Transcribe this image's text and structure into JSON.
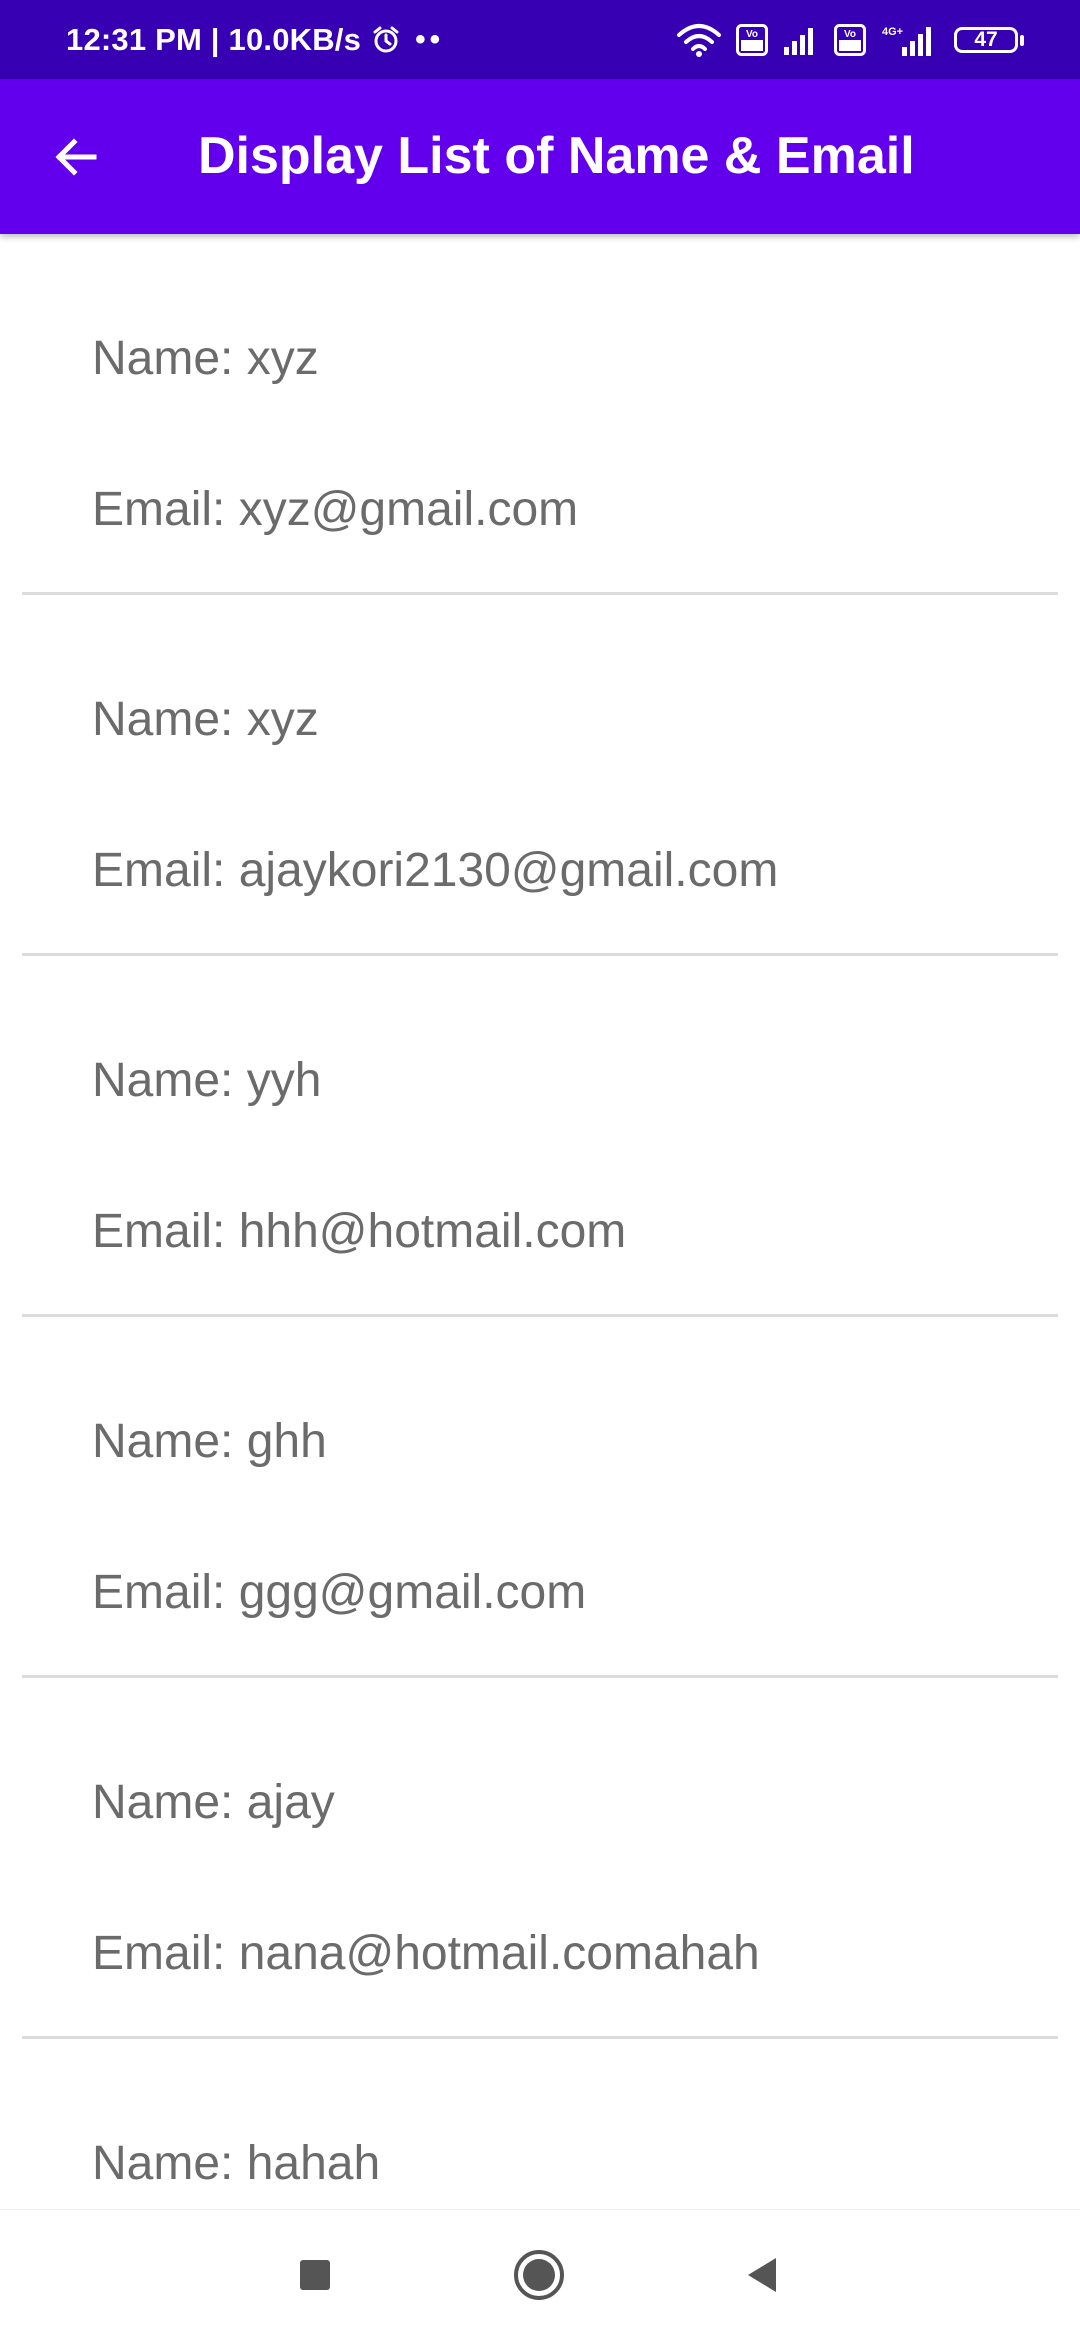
{
  "status_bar": {
    "time_speed": "12:31 PM | 10.0KB/s",
    "volte_1": "Vo\nLTE",
    "volte_2": "Vo\nLTE",
    "network_label": "4G+",
    "battery": "47",
    "icons": [
      "alarm-icon",
      "wifi-icon",
      "volte-icon",
      "signal-icon",
      "volte-icon",
      "signal-icon",
      "battery-icon"
    ]
  },
  "app_bar": {
    "title": "Display List of Name & Email",
    "back_icon": "arrow-left-icon"
  },
  "list": {
    "items": [
      {
        "name": "Name: xyz",
        "email": "Email: xyz@gmail.com"
      },
      {
        "name": "Name: xyz",
        "email": "Email: ajaykori2130@gmail.com"
      },
      {
        "name": "Name: yyh",
        "email": "Email: hhh@hotmail.com"
      },
      {
        "name": "Name: ghh",
        "email": "Email: ggg@gmail.com"
      },
      {
        "name": "Name: ajay",
        "email": "Email: nana@hotmail.comahah"
      },
      {
        "name": "Name: hahah",
        "email": ""
      }
    ]
  },
  "nav_bar": {
    "icons": [
      "recents-square-icon",
      "home-circle-icon",
      "back-triangle-icon"
    ]
  },
  "colors": {
    "status_bar": "#3700b3",
    "app_bar": "#6200ee",
    "list_text": "#6b6b6b",
    "divider": "#dcdcdc"
  }
}
